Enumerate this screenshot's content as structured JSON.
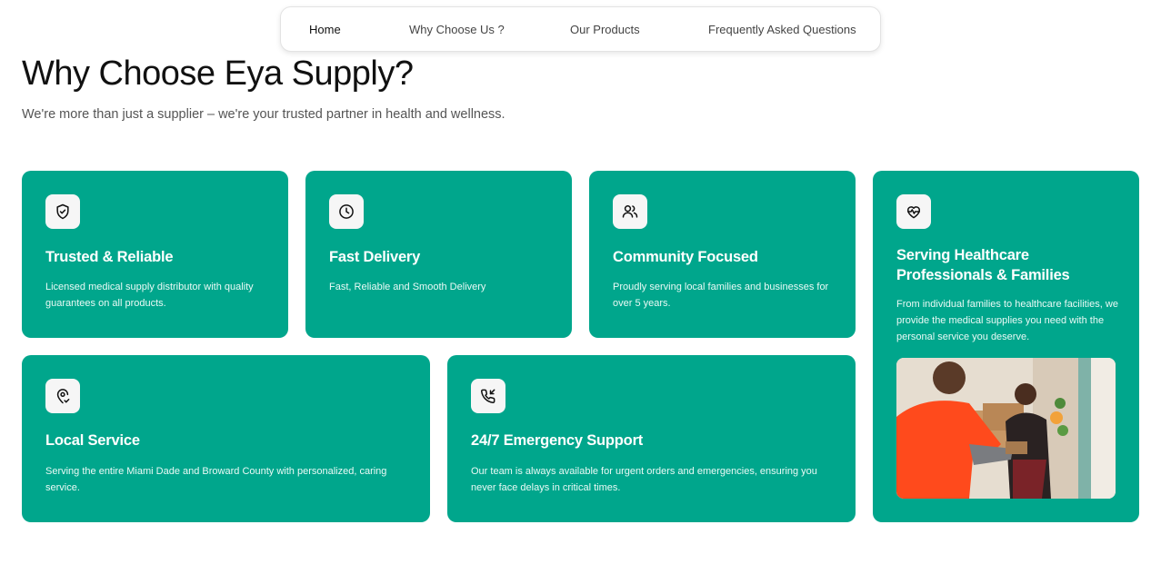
{
  "nav": {
    "items": [
      "Home",
      "Why Choose Us ?",
      "Our Products",
      "Frequently Asked Questions"
    ]
  },
  "hero": {
    "title": "Why Choose Eya Supply?",
    "subtitle": "We're more than just a supplier – we're your trusted partner in health and wellness."
  },
  "cards": [
    {
      "title": "Trusted & Reliable",
      "text": "Licensed medical supply distributor with quality guarantees on all products.",
      "icon": "shield-check-icon"
    },
    {
      "title": "Fast Delivery",
      "text": "Fast, Reliable and Smooth Delivery",
      "icon": "clock-icon"
    },
    {
      "title": "Community Focused",
      "text": "Proudly serving local families and businesses for over 5 years.",
      "icon": "users-icon"
    },
    {
      "title": "Serving Healthcare Professionals & Families",
      "text": "From individual families to healthcare facilities, we provide the medical supplies you need with the personal service you deserve.",
      "icon": "heart-pulse-icon"
    },
    {
      "title": "Local Service",
      "text": "Serving the entire Miami Dade and Broward County with personalized, caring service.",
      "icon": "location-check-icon"
    },
    {
      "title": "24/7 Emergency Support",
      "text": "Our team is always available for urgent orders and emergencies, ensuring you never face delays in critical times.",
      "icon": "phone-incoming-icon"
    }
  ],
  "colors": {
    "card_bg": "#00a68c",
    "icon_bg": "#f6f6f6"
  }
}
